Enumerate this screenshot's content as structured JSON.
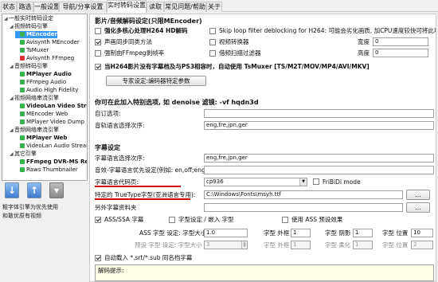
{
  "tabs": [
    "状态",
    "路选",
    "一般设置",
    "导航/分享设置",
    "实时转码设置",
    "读取",
    "常见问题/帮助",
    "关于"
  ],
  "tree": {
    "items": [
      {
        "label": "一般实时转码设定",
        "indent": 0,
        "bold": false,
        "sel": false,
        "icon": ""
      },
      {
        "label": "视频转码引擎",
        "indent": 1,
        "bold": false,
        "sel": false,
        "icon": ""
      },
      {
        "label": "MEncoder",
        "indent": 2,
        "bold": true,
        "sel": true,
        "icon": "g"
      },
      {
        "label": "Avisynth MEncoder",
        "indent": 2,
        "bold": false,
        "sel": false,
        "icon": "g"
      },
      {
        "label": "TsMuxer",
        "indent": 2,
        "bold": false,
        "sel": false,
        "icon": "g"
      },
      {
        "label": "Avisynth FFmpeg",
        "indent": 2,
        "bold": false,
        "sel": false,
        "icon": "r"
      },
      {
        "label": "音频转码引擎",
        "indent": 1,
        "bold": false,
        "sel": false,
        "icon": ""
      },
      {
        "label": "MPlayer Audio",
        "indent": 2,
        "bold": true,
        "sel": false,
        "icon": "g"
      },
      {
        "label": "FFmpeg Audio",
        "indent": 2,
        "bold": false,
        "sel": false,
        "icon": "g"
      },
      {
        "label": "Audio High Fidelity",
        "indent": 2,
        "bold": false,
        "sel": false,
        "icon": "g"
      },
      {
        "label": "视频网络串流引擎",
        "indent": 1,
        "bold": false,
        "sel": false,
        "icon": ""
      },
      {
        "label": "VideoLan Video Streaming",
        "indent": 2,
        "bold": true,
        "sel": false,
        "icon": "g"
      },
      {
        "label": "MEncoder Web",
        "indent": 2,
        "bold": false,
        "sel": false,
        "icon": "g"
      },
      {
        "label": "MPlayer Video Dump",
        "indent": 2,
        "bold": false,
        "sel": false,
        "icon": "g"
      },
      {
        "label": "音频网络串流引擎",
        "indent": 1,
        "bold": false,
        "sel": false,
        "icon": ""
      },
      {
        "label": "MPlayer Web",
        "indent": 2,
        "bold": true,
        "sel": false,
        "icon": "g"
      },
      {
        "label": "VideoLan Audio Streaming",
        "indent": 2,
        "bold": false,
        "sel": false,
        "icon": "g"
      },
      {
        "label": "其它引擎",
        "indent": 1,
        "bold": false,
        "sel": false,
        "icon": ""
      },
      {
        "label": "FFmpeg DVR-MS Remux",
        "indent": 2,
        "bold": true,
        "sel": false,
        "icon": "g"
      },
      {
        "label": "Raws Thumbnailer",
        "indent": 2,
        "bold": false,
        "sel": false,
        "icon": "g"
      }
    ],
    "note1": "粗字体引擎为优先使用",
    "note2": "和敢优原有视频"
  },
  "sec1": {
    "title": "影片/音频解码设定(只限MEncoder)",
    "multicore": "强化多核心处理H264 HD解码",
    "skiploop": "Skip loop filter deblocking for H264: 可能会劣化画质, 加CPU速度较快可将此项停用!!",
    "audiosync": "声画同步同类方法",
    "videofilter": "视频转换器",
    "width_label": "宽度",
    "width_val": "0",
    "forcefps": "强制由FFmpeg剥帧率",
    "lowbit": "借频扫描过滤器",
    "height_label": "高度",
    "height_val": "0",
    "ps3note": "当H264影片没有字幕档及与PS3相容时，自动使用 TsMuxer [TS/M2T/MOV/MP4/AVI/MKV]",
    "adv_btn": "专家设定:编码器特定参数"
  },
  "sec2": {
    "title": "你可在此加入特别选项, 如 denoise 滤镜: -vf hqdn3d",
    "custom_label": "自订选项:",
    "custom_val": "",
    "lang_label": "音轨语言选择次序:",
    "lang_val": "eng,fre,jpn,ger"
  },
  "sec3": {
    "title": "字幕设定",
    "sublang_label": "字幕语言选择次序:",
    "sublang_val": "eng,fre,jpn,ger",
    "audiosub_label": "音效-字幕语言优先设定(例如: en,off;eng,off )",
    "audiosub_val": "",
    "codepage_label": "字幕语言代码页:",
    "codepage_val": "cp936",
    "fribidi": "FriBiDi mode",
    "font_label": "特定的 TrueType字型(亚洲语言专用):",
    "font_val": "C:\\Windows\\Fonts\\msyh.ttf",
    "font_btn": "...",
    "extfolder_label": "另外字幕资料夹",
    "extfolder_btn": "...",
    "ass": "ASS/SSA 字幕",
    "fontcfg": "字型设定 / 嵌入 字型",
    "assdef": "使用 ASS 预设效果",
    "ass_size_label": "ASS 字型 设定: 字型大小",
    "ass_size_val": "1.0",
    "ass_outline_label": "字型 外框",
    "ass_outline_val": "1",
    "ass_shadow_label": "字型 阴影",
    "ass_shadow_val": "1",
    "ass_pos_label": "字型 位置",
    "ass_pos_val": "10",
    "def_size_label": "预设 字型 设定: 字型大小",
    "def_size_val": "3",
    "def_outline_label": "字型 外框",
    "def_outline_val": "1",
    "def_blur_label": "字型 柔化",
    "def_blur_val": "1",
    "def_pos_label": "字型 位置",
    "def_pos_val": "2",
    "autoload": "自动载入 *.srt/*.sub 同名档字幕",
    "decode_label": "解码提示:"
  }
}
